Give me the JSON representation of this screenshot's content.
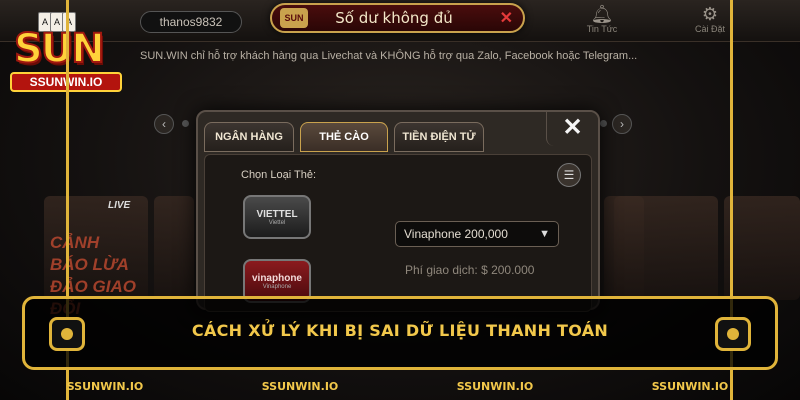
{
  "header": {
    "username": "thanos9832",
    "balance_message": "Số dư không đủ",
    "news_label": "Tin Tức",
    "settings_label": "Cài Đặt"
  },
  "logo": {
    "brand": "SUN",
    "site": "SSUNWIN.IO"
  },
  "notice_text": "SUN.WIN  chỉ hỗ trợ khách hàng qua Livechat và KHÔNG hỗ trợ qua Zalo, Facebook hoặc Telegram...",
  "background_tile": {
    "live_tag": "LIVE",
    "text": "CẢNH BÁO LỪA ĐẢO GIAO ĐỔI"
  },
  "modal": {
    "tabs": [
      "NGÂN HÀNG",
      "THẺ CÀO",
      "TIỀN ĐIỆN TỬ"
    ],
    "active_tab": "THẺ CÀO",
    "card_type_label": "Chọn Loại Thẻ:",
    "carriers": [
      {
        "name": "VIETTEL",
        "sub": "Viettel"
      },
      {
        "name": "vinaphone",
        "sub": "Vinaphone"
      }
    ],
    "selected_card": "Vinaphone 200,000",
    "fee_label": "Phí giao dịch:",
    "fee_value": "$ 200.000"
  },
  "banner": {
    "title": "CÁCH XỬ LÝ KHI BỊ SAI DỮ LIỆU THANH TOÁN"
  },
  "footer_tags": [
    "SSUNWIN.IO",
    "SSUNWIN.IO",
    "SSUNWIN.IO",
    "SSUNWIN.IO"
  ],
  "colors": {
    "gold": "#e0b43a",
    "title_gold": "#f2c84b",
    "balance_red": "#4a0d0d"
  },
  "icons": {
    "news": "bell-icon",
    "settings": "gear-icon",
    "close": "close-icon",
    "history": "history-icon",
    "balance_close": "x-icon"
  }
}
